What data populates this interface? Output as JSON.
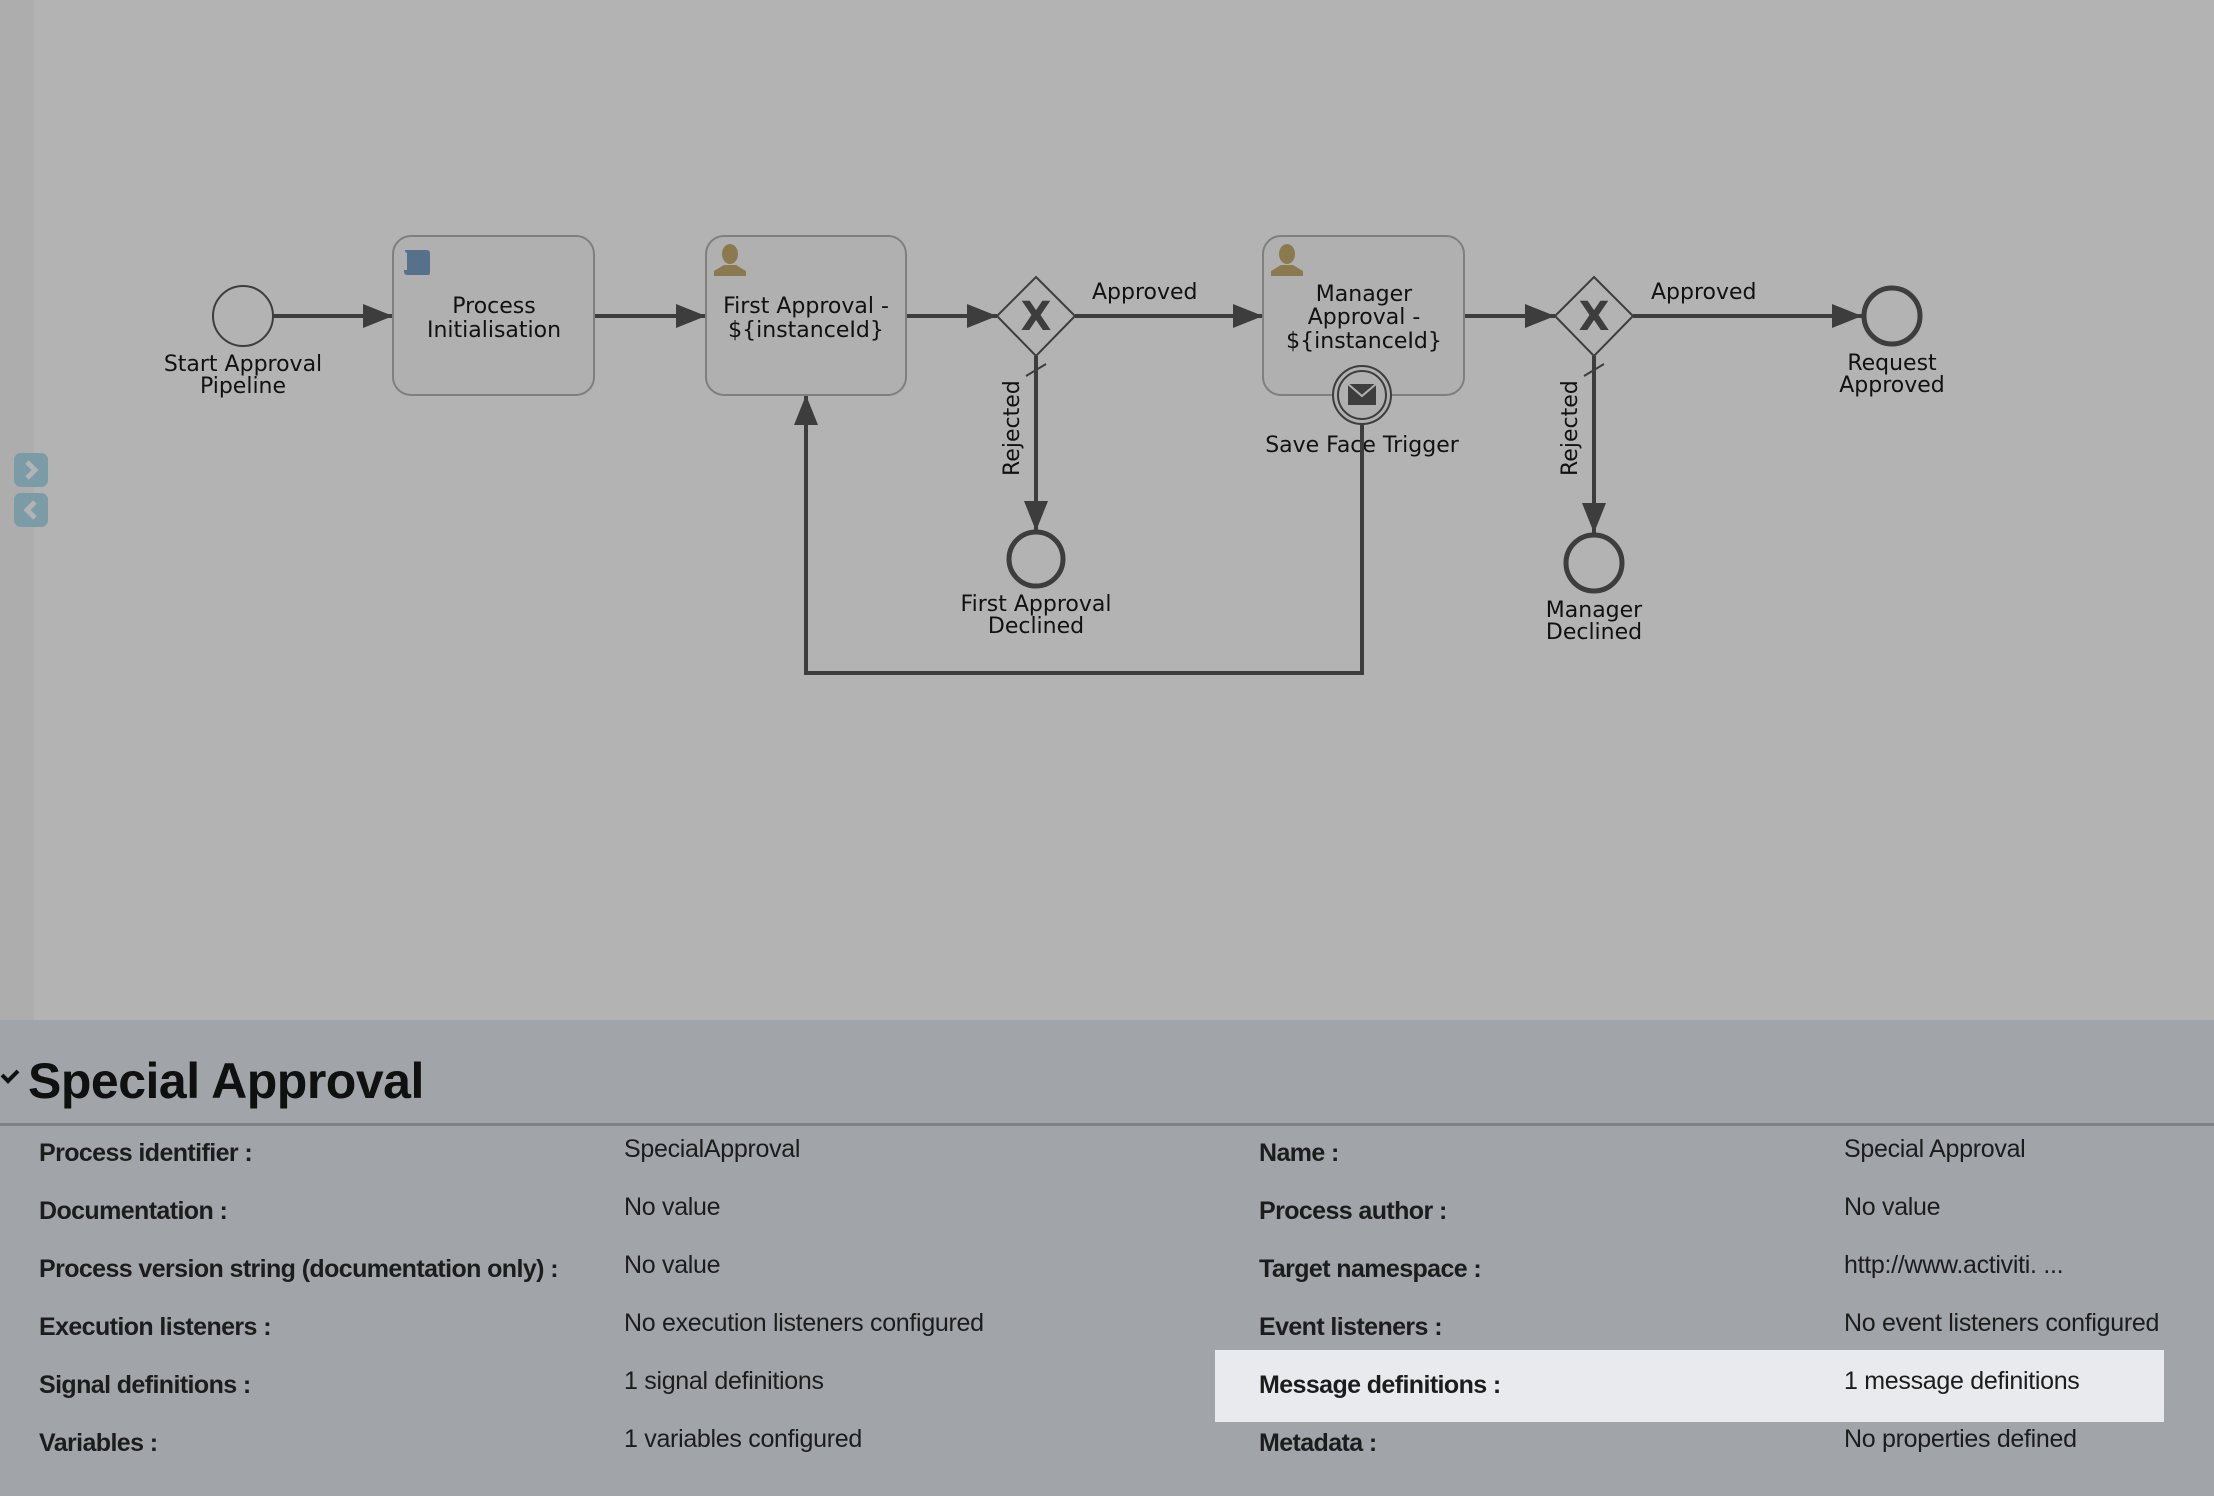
{
  "diagram": {
    "nodes": {
      "start": {
        "type": "start-event",
        "label_lines": [
          "Start Approval",
          "Pipeline"
        ]
      },
      "process_init": {
        "type": "script-task",
        "icon": "script-icon",
        "label_lines": [
          "Process",
          "Initialisation"
        ]
      },
      "first_approval": {
        "type": "user-task",
        "icon": "user-icon",
        "label_lines": [
          "First Approval -",
          "${instanceId}"
        ]
      },
      "gateway1": {
        "type": "exclusive-gateway",
        "symbol": "X"
      },
      "first_declined": {
        "type": "end-event",
        "label_lines": [
          "First Approval",
          "Declined"
        ]
      },
      "manager_approval": {
        "type": "user-task",
        "icon": "user-icon",
        "label_lines": [
          "Manager",
          "Approval -",
          "${instanceId}"
        ]
      },
      "save_face": {
        "type": "boundary-message-event",
        "icon": "envelope-icon",
        "label": "Save Face Trigger"
      },
      "gateway2": {
        "type": "exclusive-gateway",
        "symbol": "X"
      },
      "manager_declined": {
        "type": "end-event",
        "label_lines": [
          "Manager",
          "Declined"
        ]
      },
      "request_approved": {
        "type": "end-event",
        "label_lines": [
          "Request",
          "Approved"
        ]
      }
    },
    "flows": {
      "g1_approved": "Approved",
      "g1_rejected": "Rejected",
      "g2_approved": "Approved",
      "g2_rejected": "Rejected"
    },
    "colors": {
      "user_icon": "#8b7a50",
      "script_icon": "#57718c",
      "stroke": "#3d3d3d",
      "nav_button": "#7b9ba6"
    }
  },
  "nav": {
    "expand_icon": "chevron-right-icon",
    "collapse_icon": "chevron-left-icon"
  },
  "properties": {
    "title": "Special Approval",
    "collapse_icon": "checkmark-chevron-icon",
    "left": [
      {
        "label": "Process identifier :",
        "value": "SpecialApproval"
      },
      {
        "label": "Documentation :",
        "value": "No value"
      },
      {
        "label": "Process version string (documentation only) :",
        "value": "No value"
      },
      {
        "label": "Execution listeners :",
        "value": "No execution listeners configured"
      },
      {
        "label": "Signal definitions :",
        "value": "1 signal definitions"
      },
      {
        "label": "Variables :",
        "value": "1 variables configured"
      }
    ],
    "right": [
      {
        "label": "Name :",
        "value": "Special Approval"
      },
      {
        "label": "Process author :",
        "value": "No value"
      },
      {
        "label": "Target namespace :",
        "value": "http://www.activiti. ..."
      },
      {
        "label": "Event listeners :",
        "value": "No event listeners configured"
      },
      {
        "label": "Message definitions :",
        "value": "1 message definitions",
        "highlighted": true
      },
      {
        "label": "Metadata :",
        "value": "No properties defined"
      }
    ],
    "highlight_color": "#e8eaee"
  }
}
